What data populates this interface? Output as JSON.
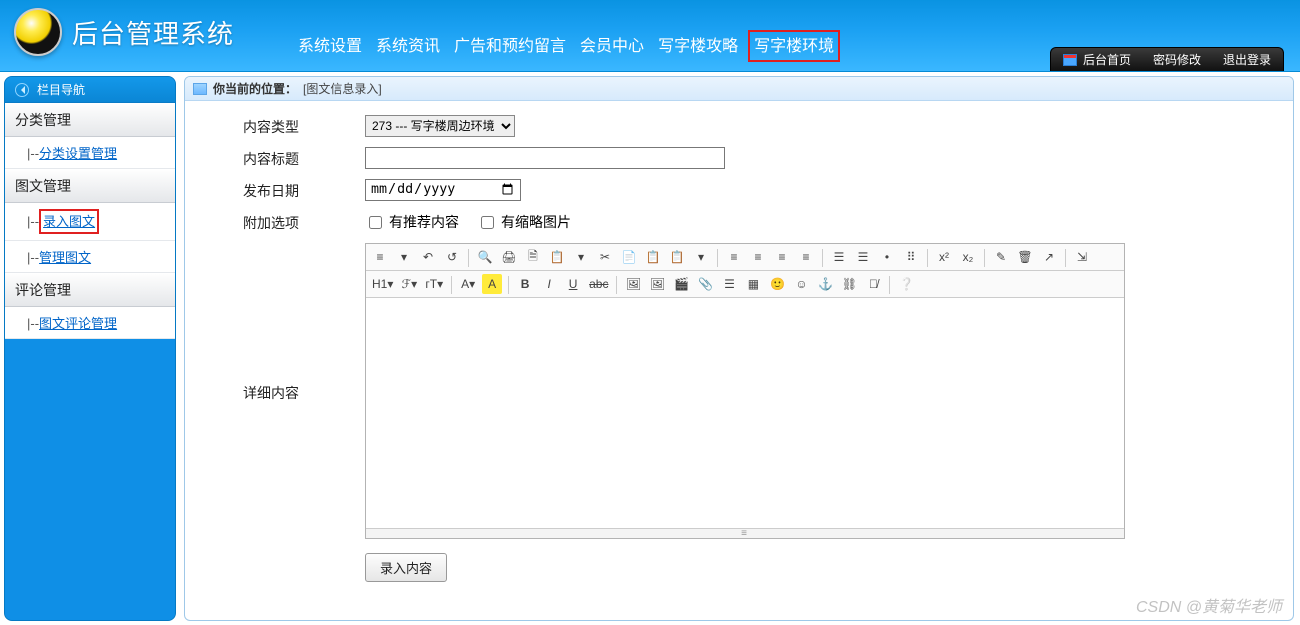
{
  "header": {
    "system_title": "后台管理系统",
    "nav": [
      "系统设置",
      "系统资讯",
      "广告和预约留言",
      "会员中心",
      "写字楼攻略",
      "写字楼环境"
    ],
    "highlight_index": 5
  },
  "top_right": {
    "home": "后台首页",
    "pwd": "密码修改",
    "logout": "退出登录"
  },
  "sidebar": {
    "title": "栏目导航",
    "groups": [
      {
        "label": "分类管理",
        "subs": [
          "分类设置管理"
        ]
      },
      {
        "label": "图文管理",
        "subs": [
          "录入图文",
          "管理图文"
        ],
        "mark_index": 0
      },
      {
        "label": "评论管理",
        "subs": [
          "图文评论管理"
        ]
      }
    ],
    "sub_prefix": "|--"
  },
  "breadcrumb": {
    "label": "你当前的位置：",
    "location": "[图文信息录入]"
  },
  "form": {
    "type_label": "内容类型",
    "type_option": "273 --- 写字楼周边环境",
    "title_label": "内容标题",
    "title_value": "",
    "date_label": "发布日期",
    "date_placeholder": "年 /月/日",
    "options_label": "附加选项",
    "cbx1": "有推荐内容",
    "cbx2": "有缩略图片",
    "detail_label": "详细内容",
    "submit": "录入内容"
  },
  "editor": {
    "row1": [
      "≡",
      "▾",
      "↶",
      "↺",
      "│",
      "🔍",
      "🖨",
      "🗎",
      "📋",
      "▾",
      "✂",
      "📄",
      "📋",
      "📋",
      "▾",
      "│",
      "≡",
      "≡",
      "≡",
      "≡",
      "│",
      "☰",
      "☰",
      "•",
      "⠿",
      "│",
      "x²",
      "x₂",
      "│",
      "✎",
      "🗑",
      "↗",
      "│",
      "⇲"
    ],
    "row2": [
      "H1▾",
      "ℱ▾",
      "гT▾",
      "│",
      "A▾",
      "Y",
      "│",
      "B",
      "I",
      "U",
      "abc",
      "│",
      "🖼",
      "🖼",
      "🎬",
      "📎",
      "☰",
      "▦",
      "🙂",
      "☺",
      "⚓",
      "⛓",
      "⛓̸",
      "│",
      "❔"
    ],
    "resizer": "≡"
  },
  "watermark": "CSDN @黄菊华老师"
}
